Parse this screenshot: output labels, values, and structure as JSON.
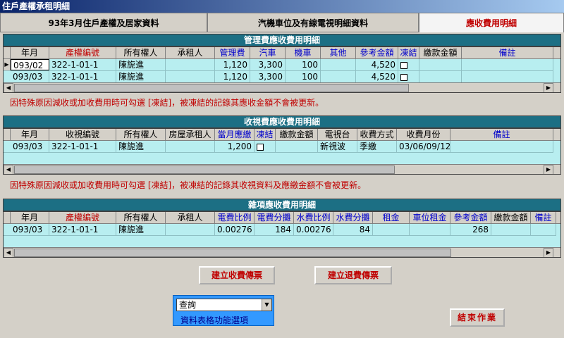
{
  "window": {
    "title": "住戶產權承租明細"
  },
  "tabs": [
    {
      "label": "93年3月住戶產權及居家資料"
    },
    {
      "label": "汽機車位及有線電視明細資料"
    },
    {
      "label": "應收費用明細"
    }
  ],
  "mgmt": {
    "title": "管理費應收費用明細",
    "headers": [
      "年月",
      "產權編號",
      "所有權人",
      "承租人",
      "管理費",
      "汽車",
      "機車",
      "其他",
      "參考金額",
      "凍結",
      "繳款金額",
      "備註"
    ],
    "rows": [
      {
        "ym": "093/02",
        "id": "322-1-01-1",
        "owner": "陳旎進",
        "tenant": "",
        "fee": "1,120",
        "car": "3,300",
        "moto": "100",
        "other": "",
        "ref": "4,520",
        "paid": "",
        "memo": ""
      },
      {
        "ym": "093/03",
        "id": "322-1-01-1",
        "owner": "陳旎進",
        "tenant": "",
        "fee": "1,120",
        "car": "3,300",
        "moto": "100",
        "other": "",
        "ref": "4,520",
        "paid": "",
        "memo": ""
      }
    ],
    "note": "因特殊原因減收或加收費用時可勾選 [凍結]，被凍結的記錄其應收金額不會被更新。"
  },
  "tv": {
    "title": "收視費應收費用明細",
    "headers": [
      "年月",
      "收視編號",
      "所有權人",
      "房屋承租人",
      "當月應繳",
      "凍結",
      "繳款金額",
      "電視台",
      "收費方式",
      "收費月份",
      "備註"
    ],
    "rows": [
      {
        "ym": "093/03",
        "id": "322-1-01-1",
        "owner": "陳旎進",
        "tenant": "",
        "due": "1,200",
        "paid": "",
        "station": "新視波",
        "method": "季繳",
        "months": "03/06/09/12",
        "memo": ""
      }
    ],
    "note": "因特殊原因減收或加收費用時可勾選 [凍結]，被凍結的記錄其收視資料及應繳金額不會被更新。"
  },
  "misc": {
    "title": "雜項應收費用明細",
    "headers": [
      "年月",
      "產權編號",
      "所有權人",
      "承租人",
      "電費比例",
      "電費分攤",
      "水費比例",
      "水費分攤",
      "租金",
      "車位租金",
      "參考金額",
      "繳款金額",
      "備註"
    ],
    "rows": [
      {
        "ym": "093/03",
        "id": "322-1-01-1",
        "owner": "陳旎進",
        "tenant": "",
        "eratio": "0.00276",
        "eshare": "184",
        "wratio": "0.00276",
        "wshare": "84",
        "rent": "",
        "prent": "",
        "ref": "268",
        "paid": "",
        "memo": ""
      }
    ]
  },
  "buttons": {
    "create_receipt": "建立收費傳票",
    "create_refund": "建立退費傳票",
    "close": "結束作業"
  },
  "selector": {
    "value": "查詢",
    "label": "資料表格功能選項"
  }
}
